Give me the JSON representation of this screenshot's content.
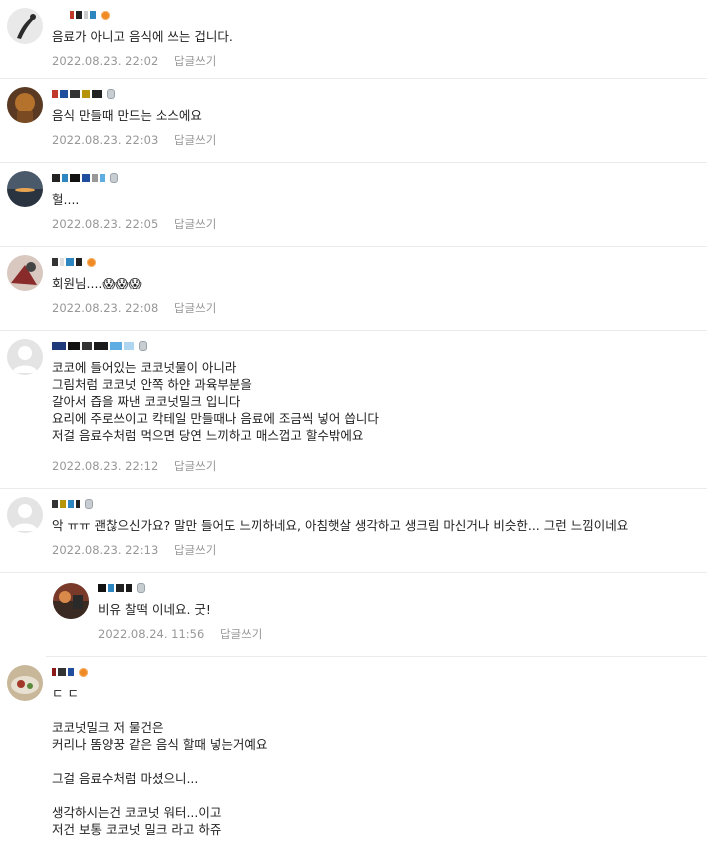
{
  "comments": [
    {
      "text": "음료가 아니고 음식에 쓰는 겁니다.",
      "date": "2022.08.23. 22:02",
      "reply_label": "답글쓰기"
    },
    {
      "text": "음식 만들때 만드는 소스에요",
      "date": "2022.08.23. 22:03",
      "reply_label": "답글쓰기"
    },
    {
      "text": "헐....",
      "date": "2022.08.23. 22:05",
      "reply_label": "답글쓰기"
    },
    {
      "text": "회원님....😱😱😱",
      "date": "2022.08.23. 22:08",
      "reply_label": "답글쓰기"
    },
    {
      "text": "코코에 들어있는 코코넛물이 아니라\n그림처럼 코코넛 안쪽 하얀 과육부분을\n갈아서 즙을 짜낸 코코넛밀크 입니다\n요리에 주로쓰이고 칵테일 만들때나 음료에 조금씩 넣어 씁니다\n저걸 음료수처럼 먹으면 당연 느끼하고 매스껍고 할수밖에요",
      "date": "2022.08.23. 22:12",
      "reply_label": "답글쓰기"
    },
    {
      "text": "악 ㅠㅠ 괜찮으신가요? 말만 들어도 느끼하네요, 아침햇살 생각하고 생크림 마신거나 비슷한... 그런 느낌이네요",
      "date": "2022.08.23. 22:13",
      "reply_label": "답글쓰기"
    },
    {
      "text": "비유 찰떡 이네요. 굿!",
      "date": "2022.08.24. 11:56",
      "reply_label": "답글쓰기"
    },
    {
      "text": "ㄷ ㄷ\n\n코코넛밀크 저 물건은\n커리나 똠양꿍 같은 음식 할때 넣는거예요\n\n그걸 음료수처럼 마셨으니...\n\n생각하시는건 코코넛 워터...이고\n저건 보통 코코넛 밀크 라고 하쥬",
      "date": "",
      "reply_label": ""
    }
  ],
  "colors": {
    "meta": "#979797",
    "divider": "#ebebeb",
    "badge_orange": "#f08a24",
    "badge_silver": "#c8cdd2"
  }
}
